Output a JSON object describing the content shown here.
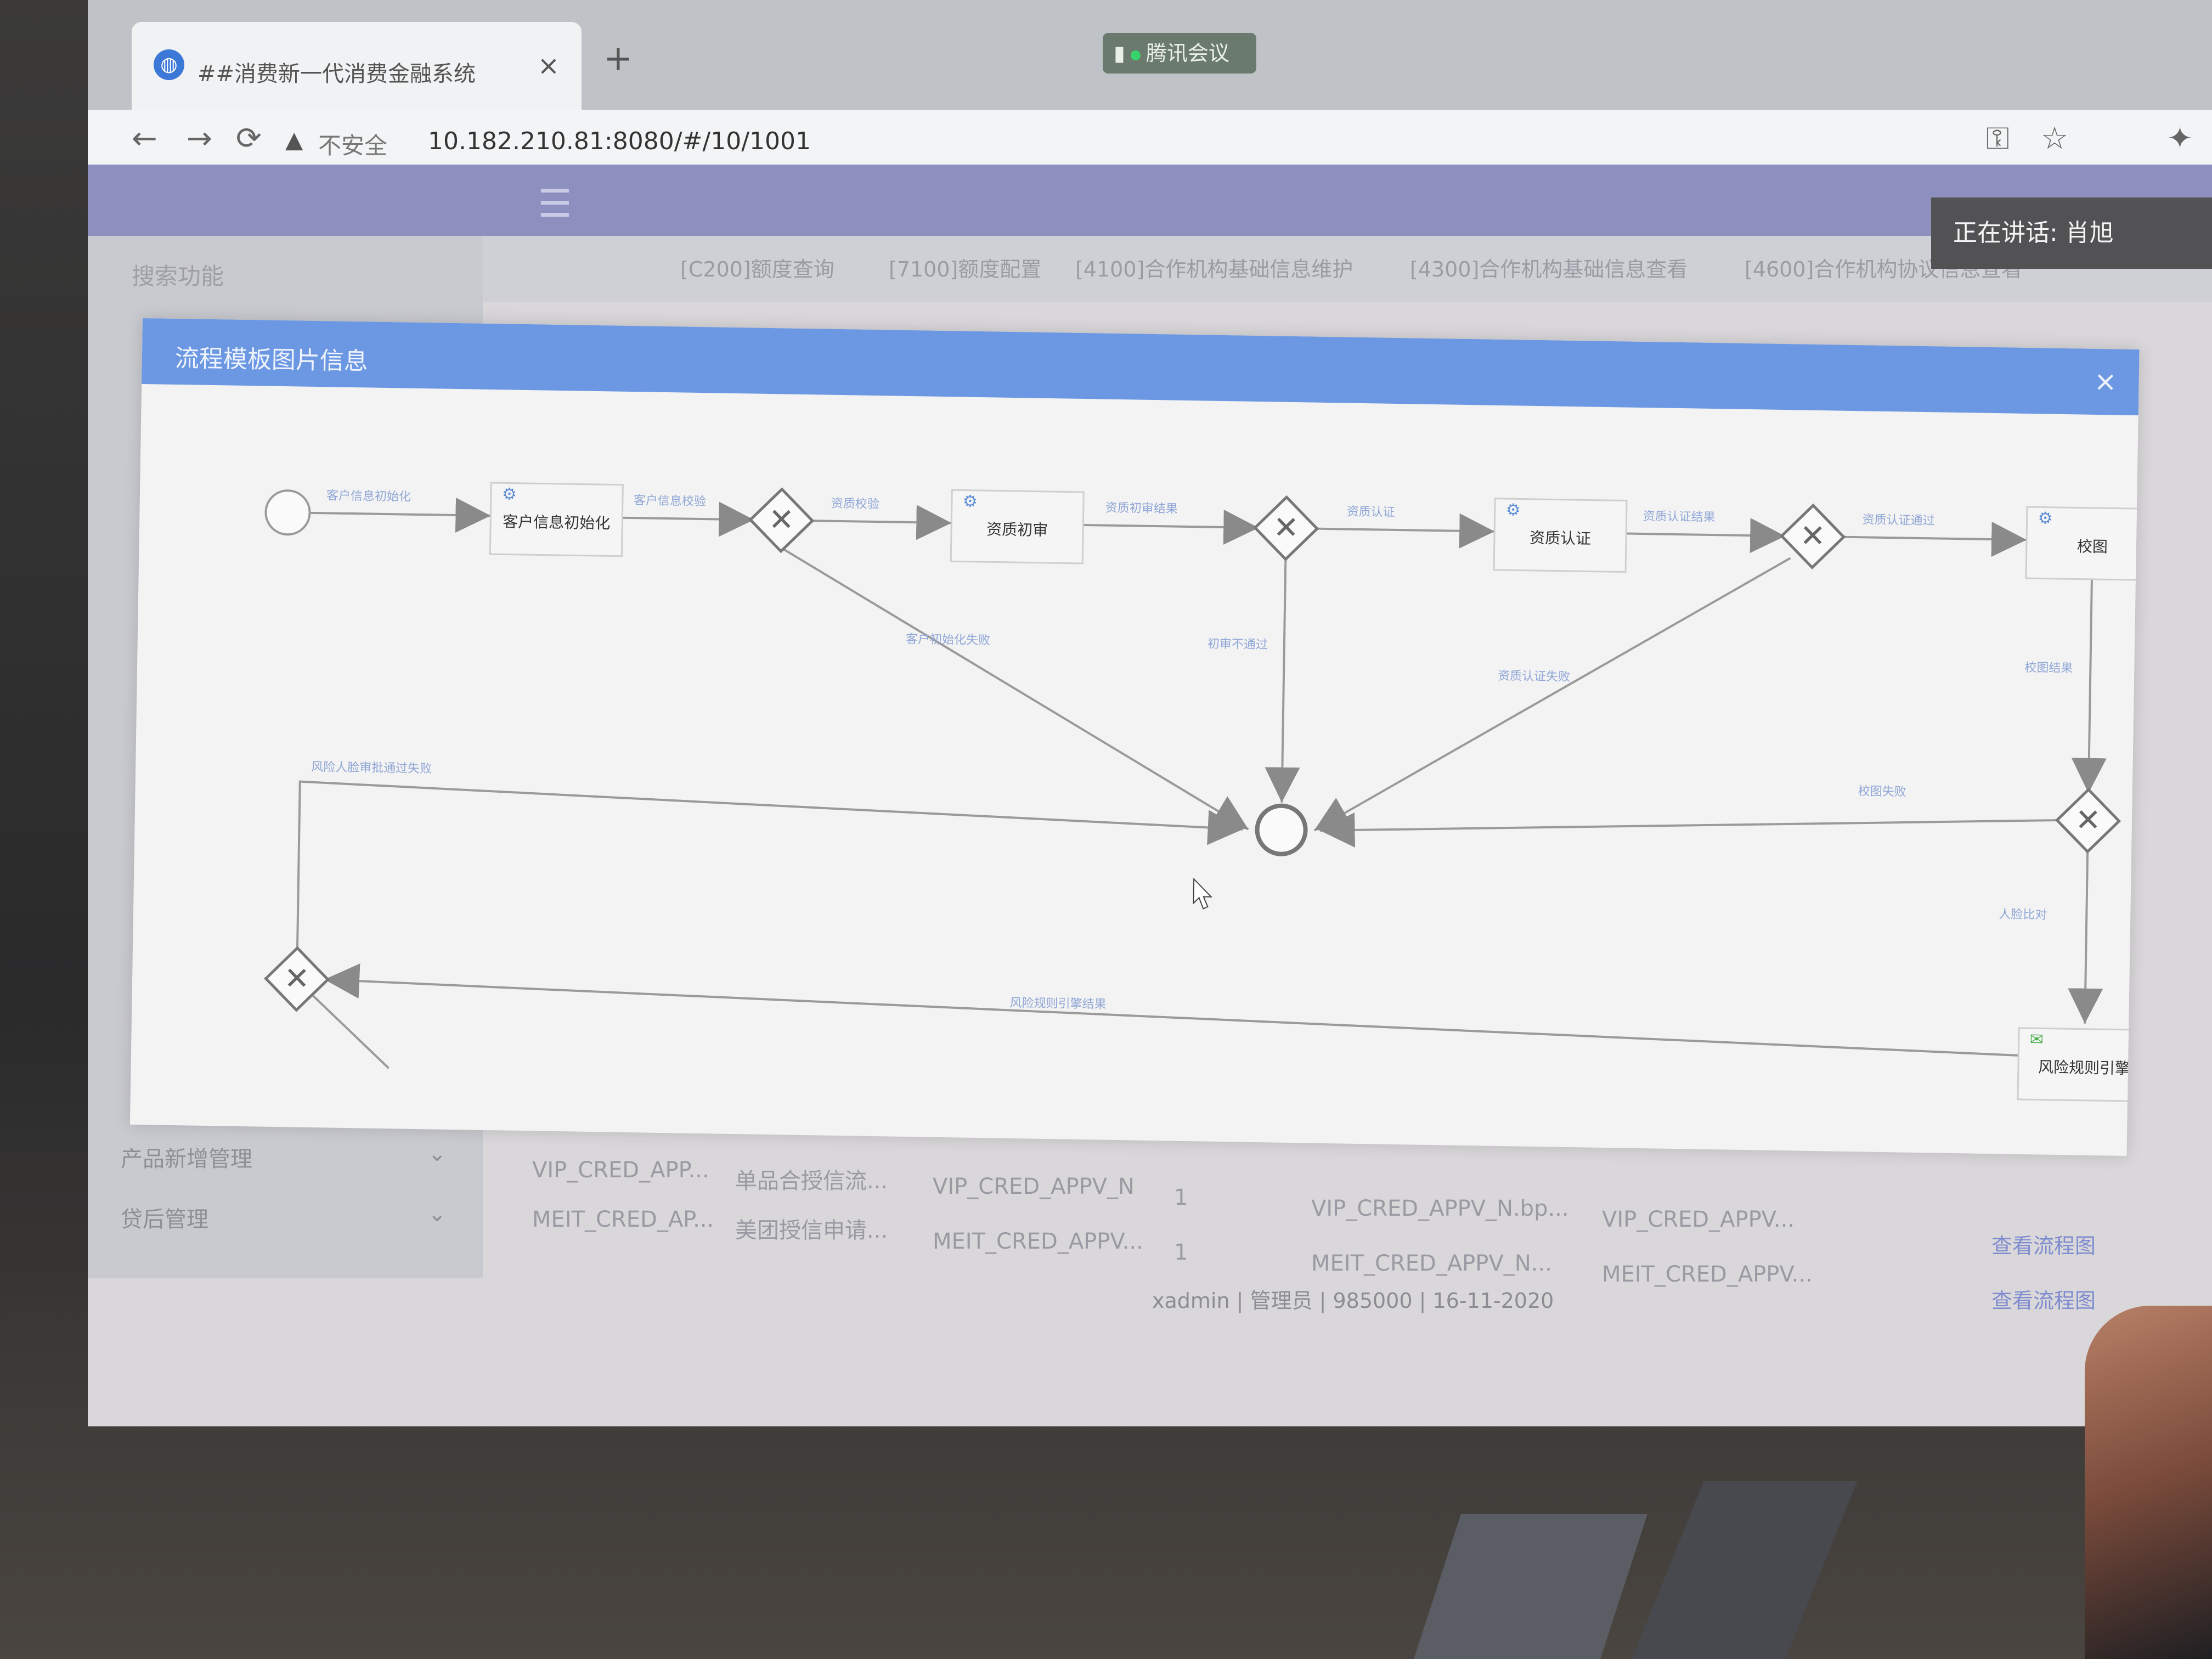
{
  "browser": {
    "tab_title": "##消费新一代消费金融系统",
    "tab_close": "×",
    "new_tab": "+",
    "meeting_app": "腾讯会议",
    "address": {
      "warning_icon": "warning-icon",
      "insecure_label": "不安全",
      "url": "10.182.210.81:8080/#/10/1001"
    },
    "nav": {
      "back": "←",
      "forward": "→",
      "reload": "⟳"
    },
    "right_icons": {
      "key": "⚿",
      "star": "☆",
      "ext": "✦"
    }
  },
  "app": {
    "menu_toggle": "☰",
    "speaker": "正在讲话: 肖旭",
    "sidebar": {
      "search_placeholder": "搜索功能",
      "items": [
        {
          "label": "产品新增管理",
          "chevron": "⌄"
        },
        {
          "label": "贷后管理",
          "chevron": "⌄"
        }
      ]
    },
    "tabs": [
      "[C200]额度查询",
      "[7100]额度配置",
      "[4100]合作机构基础信息维护",
      "[4300]合作机构基础信息查看",
      "[4600]合作机构协议信息查看"
    ],
    "table": {
      "rows": [
        [
          "VIP_CRED_APP...",
          "单品合授信流...",
          "VIP_CRED_APPV_N",
          "1",
          "VIP_CRED_APPV_N.bp...",
          "VIP_CRED_APPV..."
        ],
        [
          "MEIT_CRED_AP...",
          "美团授信申请...",
          "MEIT_CRED_APPV...",
          "1",
          "MEIT_CRED_APPV_N...",
          "MEIT_CRED_APPV..."
        ]
      ],
      "links": [
        "查看流程图",
        "查看流程图"
      ]
    },
    "footer": "xadmin | 管理员 | 985000 | 16-11-2020"
  },
  "modal": {
    "title": "流程模板图片信息",
    "close": "×",
    "diagram": {
      "tasks": {
        "t1": "客户信息初始化",
        "t2": "资质初审",
        "t3": "资质认证",
        "t4": "校图",
        "t5": "风险规则引擎"
      },
      "edges": {
        "e1": "客户信息初始化",
        "e2": "客户信息校验",
        "e3": "资质校验",
        "e4": "资质初审结果",
        "e5": "资质认证",
        "e6": "资质认证结果",
        "e7": "资质认证通过",
        "e8": "客户初始化失败",
        "e9": "初审不通过",
        "e10": "资质认证失败",
        "e11": "校图结果",
        "e12": "校图失败",
        "e13": "人脸比对",
        "e14": "风险规则引擎结果",
        "e15": "风险人脸审批通过失败"
      }
    }
  }
}
